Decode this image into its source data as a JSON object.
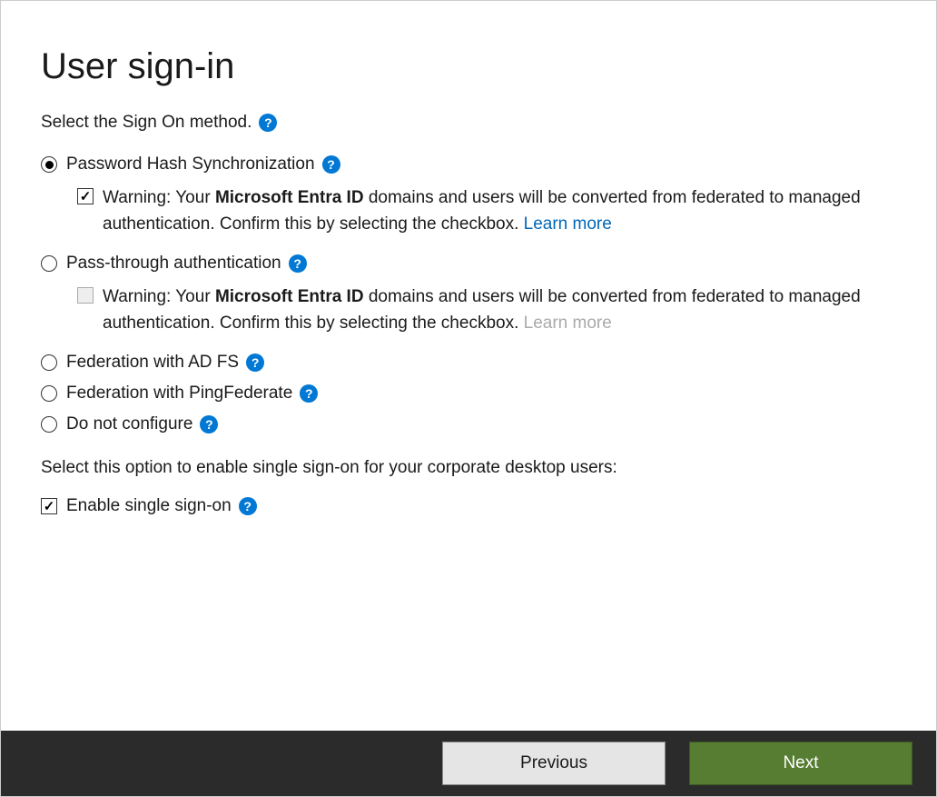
{
  "title": "User sign-in",
  "select_method_label": "Select the Sign On method.",
  "options": {
    "phs": {
      "label": "Password Hash Synchronization",
      "selected": true
    },
    "pta": {
      "label": "Pass-through authentication",
      "selected": false
    },
    "adfs": {
      "label": "Federation with AD FS",
      "selected": false
    },
    "ping": {
      "label": "Federation with PingFederate",
      "selected": false
    },
    "none": {
      "label": "Do not configure",
      "selected": false
    }
  },
  "warning": {
    "prefix": "Warning: Your ",
    "bold": "Microsoft Entra ID",
    "suffix": " domains and users will be converted from federated to managed authentication. Confirm this by selecting the checkbox. ",
    "learn_more": "Learn more"
  },
  "phs_warning_checked": true,
  "pta_warning_checked": false,
  "sso": {
    "label": "Select this option to enable single sign-on for your corporate desktop users:",
    "option": "Enable single sign-on",
    "checked": true
  },
  "buttons": {
    "previous": "Previous",
    "next": "Next"
  }
}
